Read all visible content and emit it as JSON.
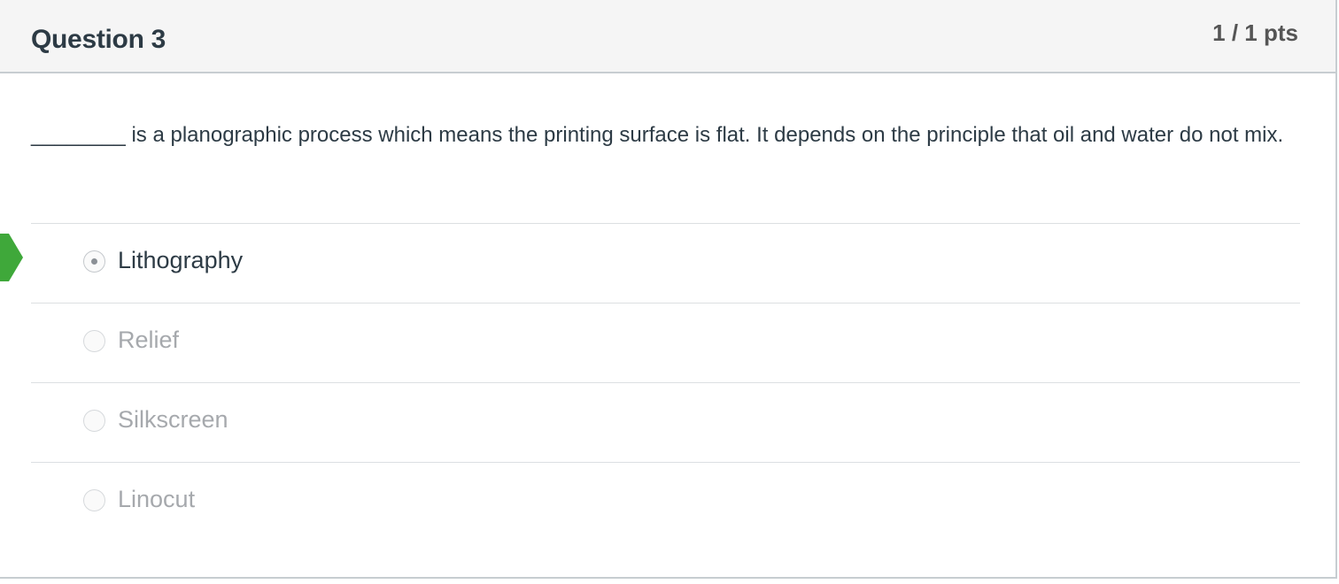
{
  "question": {
    "title": "Question 3",
    "points": "1 / 1 pts",
    "text": "________ is a planographic process which means the printing surface is flat. It depends on the principle that oil and water do not mix."
  },
  "answers": [
    {
      "label": "Lithography",
      "selected": true,
      "correct": true
    },
    {
      "label": "Relief",
      "selected": false,
      "correct": false
    },
    {
      "label": "Silkscreen",
      "selected": false,
      "correct": false
    },
    {
      "label": "Linocut",
      "selected": false,
      "correct": false
    }
  ],
  "colors": {
    "correct_marker": "#3fa83a",
    "header_bg": "#f5f5f5",
    "text": "#2d3b45",
    "muted_text": "#a6a9ad"
  },
  "icons": {
    "correct_marker": "correct-answer-arrow-icon"
  }
}
